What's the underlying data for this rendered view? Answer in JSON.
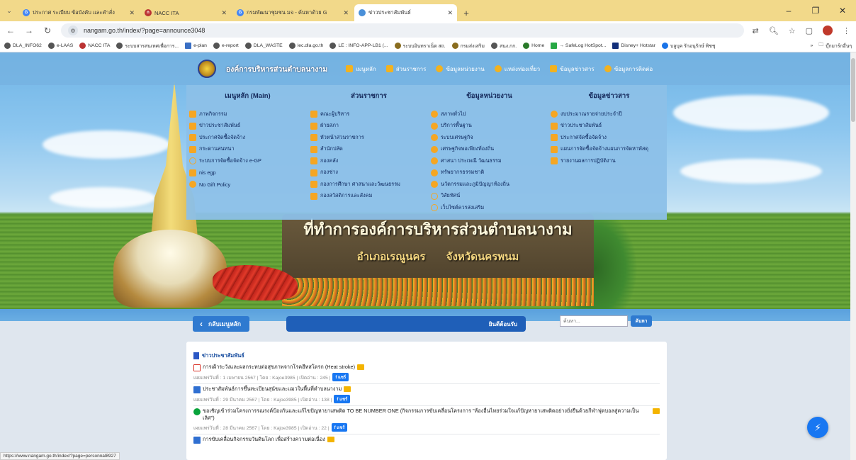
{
  "browser": {
    "tabs": [
      {
        "label": "ประกาศ ระเบียบ ข้อบังคับ และคำสั่ง ",
        "color": "#4285f4",
        "icon": "google-icon"
      },
      {
        "label": "NACC ITA",
        "color": "#b33",
        "icon": "nacc-icon"
      },
      {
        "label": "กรมพัฒนาชุมชน มจ - ค้นหาด้วย G",
        "color": "#4285f4",
        "icon": "google-icon"
      },
      {
        "label": "ข่าวประชาสัมพันธ์",
        "color": "#4a90d9",
        "icon": "site-icon",
        "active": true
      }
    ],
    "url": "nangam.go.th/index/?page=announce3048",
    "bookmarks": [
      "DLA_INFO62",
      "e-LAAS",
      "NACC ITA",
      "ระบบสารสนเทศเพื่อการ...",
      "e-plan",
      "e-report",
      "DLA_WASTE",
      "lec.dla.go.th",
      "LE : INFO-APP-LB1 (...",
      "ระบบอินทราเน็ต สถ.",
      "กรมส่งเสริม",
      "สนง.กก.",
      "Home",
      "→ SafeLog HotSpot...",
      "Disney+ Hotstar",
      "บลูบุค รักอนุรักษ์ พิชชุ"
    ],
    "bookmarks_folder": "บุ๊กมาร์กอื่นๆ",
    "status_url": "https://www.nangam.go.th/index/?page=personnal8927"
  },
  "nav": {
    "org_name": "องค์การบริหารส่วนตำบลนางาม",
    "items": [
      "เมนูหลัก",
      "ส่วนราชการ",
      "ข้อมูลหน่วยงาน",
      "แหล่งท่องเที่ยว",
      "ข้อมูลข่าวสาร",
      "ข้อมูลการติดต่อ"
    ]
  },
  "megamenu": {
    "col1": {
      "title": "เมนูหลัก (Main)",
      "items": [
        "ภาพกิจกรรม",
        "ข่าวประชาสัมพันธ์",
        "ประกาศจัดซื้อจัดจ้าง",
        "กระดานสนทนา",
        "ระบบการจัดซื้อจัดจ้าง e-GP",
        "nis egp",
        "No Gift Policy"
      ]
    },
    "col2": {
      "title": "ส่วนราชการ",
      "items": [
        "คณะผู้บริหาร",
        "ฝ่ายสภา",
        "หัวหน้าส่วนราชการ",
        "สำนักปลัด",
        "กองคลัง",
        "กองช่าง",
        "กองการศึกษา ศาสนาและวัฒนธรรม",
        "กองสวัสดิการและสังคม"
      ]
    },
    "col3": {
      "title": "ข้อมูลหน่วยงาน",
      "items": [
        "สภาพทั่วไป",
        "บริการพื้นฐาน",
        "ระบบเศรษฐกิจ",
        "เศรษฐกิจพอเพียงท้องถิ่น",
        "ศาสนา ประเพณี วัฒนธรรม",
        "ทรัพยากรธรรมชาติ",
        "นวัตกรรมและภูมิปัญญาท้องถิ่น",
        "วิสัยทัศน์",
        "เว็บไซต์ควรส่งเสริม"
      ]
    },
    "col4": {
      "title": "ข้อมูลข่าวสาร",
      "items": [
        "งบประมาณรายจ่ายประจำปี",
        "ข่าวประชาสัมพันธ์",
        "ประกาศจัดซื้อจัดจ้าง",
        "แผนการจัดซื้อจัดจ้างแผนการจัดหาพัสดุ",
        "รายงานผลการปฏิบัติงาน"
      ]
    }
  },
  "hero": {
    "title": "ที่ทำการองค์การบริหารส่วนตำบลนางาม",
    "subtitle": "อำเภอเรณูนคร จังหวัดนครพนม"
  },
  "toolbar": {
    "back_label": "กลับเมนูหลัก",
    "welcome": "ยินดีต้อนรับ",
    "search_placeholder": "ค้นหา...",
    "search_button": "ค้นหา"
  },
  "news": {
    "section_title": "ข่าวประชาสัมพันธ์",
    "share_label": "แชร์",
    "items": [
      {
        "title": "การเฝ้าระวังและผลกระทบต่อสุขภาพจากโรคฮีทสโตรก (Heat stroke)",
        "meta": "เผยแพร่วันที่ : 1 เมษายน 2567 | โดย : Kajoe3985 | เปิดอ่าน : 245 |",
        "icon": "pdf"
      },
      {
        "title": "ประชาสัมพันธ์การขึ้นทะเบียนสุนัขและแมวในพื้นที่ตำบลนางาม",
        "meta": "เผยแพร่วันที่ : 29 มีนาคม 2567 | โดย : Kajoe3985 | เปิดอ่าน : 138 |",
        "icon": "img"
      },
      {
        "title": "ขอเชิญเข้าร่วมโครงการรณรงค์ป้องกันและแก้ไขปัญหายาเสพติด TO BE NUMBER ONE (กิจกรรมการขับเคลื่อนโครงการ \"ห้องอื่นไทยร่วมใจแก้ปัญหายาเสพติดอย่างยั่งยืนด้วยกีฬาฟุตบอลสู่ความเป็นเลิศ\")",
        "meta": "เผยแพร่วันที่ : 28 มีนาคม 2567 | โดย : Kajoe3985 | เปิดอ่าน : 22 |",
        "icon": "line"
      },
      {
        "title": "การขับเคลื่อนกิจกรรมวันดินโลก เพื่อสร้างความต่อเนื่อง",
        "meta": "",
        "icon": "img"
      }
    ]
  }
}
